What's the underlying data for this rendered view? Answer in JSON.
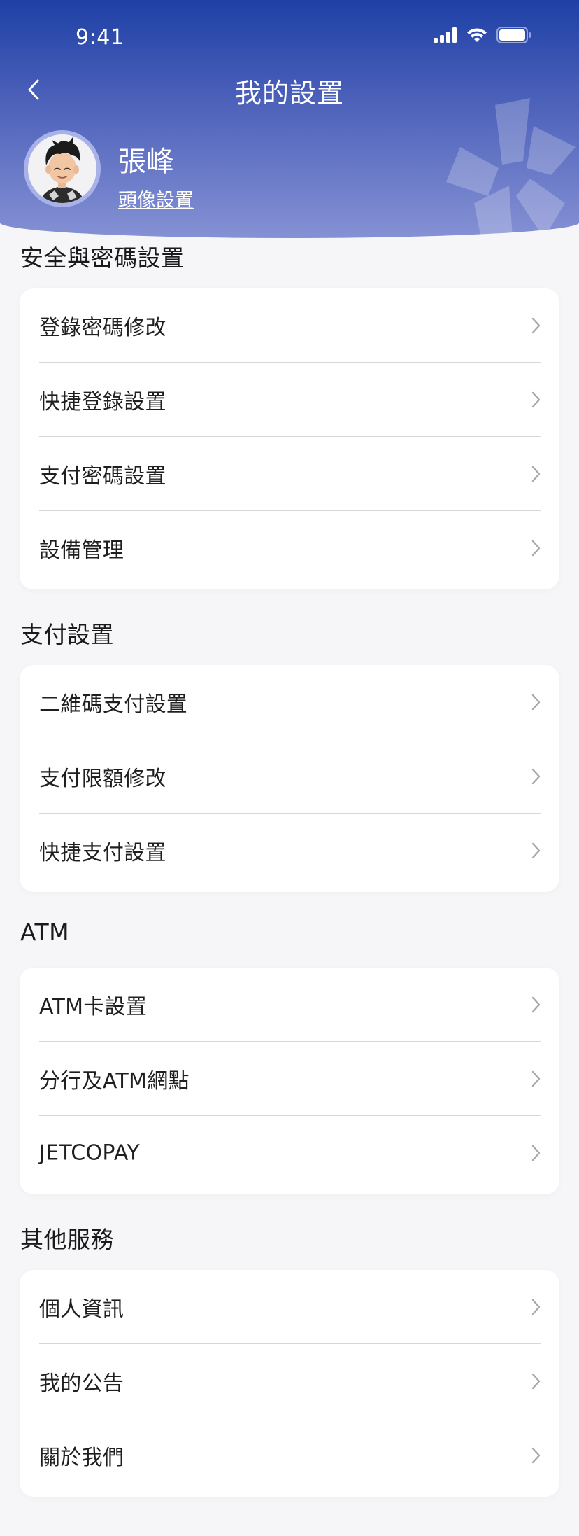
{
  "status_bar": {
    "time": "9:41",
    "icons": [
      "cellular-signal-icon",
      "wifi-icon",
      "battery-icon"
    ]
  },
  "header": {
    "title": "我的設置",
    "back_icon": "chevron-left-icon"
  },
  "profile": {
    "name": "張峰",
    "avatar_link": "頭像設置"
  },
  "sections": [
    {
      "title": "安全與密碼設置",
      "items": [
        "登錄密碼修改",
        "快捷登錄設置",
        "支付密碼設置",
        "設備管理"
      ]
    },
    {
      "title": "支付設置",
      "items": [
        "二維碼支付設置",
        "支付限額修改",
        "快捷支付設置"
      ]
    },
    {
      "title": "ATM",
      "items": [
        "ATM卡設置",
        "分行及ATM網點",
        "JETCOPAY"
      ]
    },
    {
      "title": "其他服務",
      "items": [
        "個人資訊",
        "我的公告",
        "關於我們"
      ]
    }
  ],
  "colors": {
    "header_top": "#1e40a6",
    "header_bottom": "#8591d4",
    "page_background": "#f6f6f8",
    "card_background": "#ffffff",
    "chevron": "#a8a8a8"
  }
}
